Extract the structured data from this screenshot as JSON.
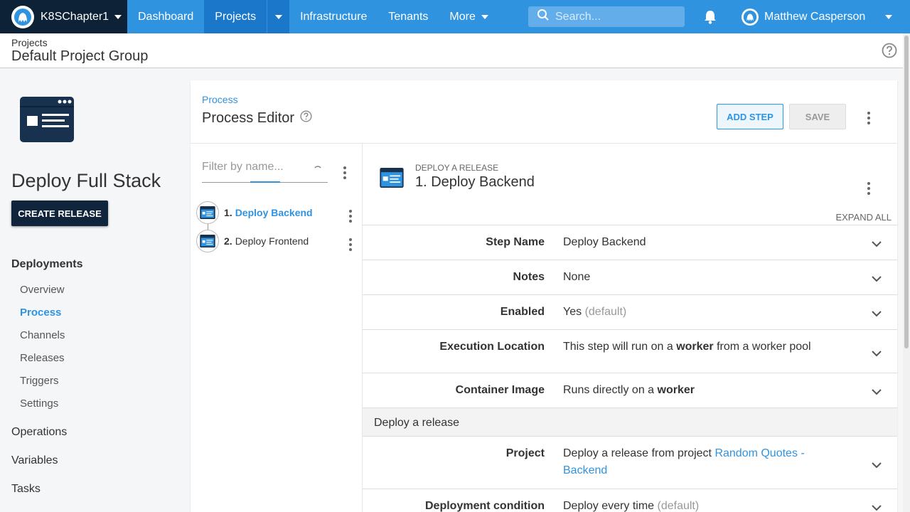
{
  "topnav": {
    "brand": "K8SChapter1",
    "items": [
      {
        "label": "Dashboard"
      },
      {
        "label": "Projects"
      },
      {
        "label": "Infrastructure"
      },
      {
        "label": "Tenants"
      },
      {
        "label": "More"
      }
    ],
    "search_placeholder": "Search...",
    "user_name": "Matthew Casperson"
  },
  "header": {
    "breadcrumb": "Projects",
    "title": "Default Project Group"
  },
  "sidebar": {
    "project_name": "Deploy Full Stack",
    "create_release": "CREATE RELEASE",
    "deployments": "Deployments",
    "sub_items": [
      {
        "label": "Overview"
      },
      {
        "label": "Process"
      },
      {
        "label": "Channels"
      },
      {
        "label": "Releases"
      },
      {
        "label": "Triggers"
      },
      {
        "label": "Settings"
      }
    ],
    "groups": [
      {
        "label": "Operations"
      },
      {
        "label": "Variables"
      },
      {
        "label": "Tasks"
      }
    ]
  },
  "editor": {
    "breadcrumb": "Process",
    "title": "Process Editor",
    "add_step": "ADD STEP",
    "save": "SAVE",
    "filter_placeholder": "Filter by name...",
    "steps": [
      {
        "num": "1.",
        "label": "Deploy Backend"
      },
      {
        "num": "2.",
        "label": "Deploy Frontend"
      }
    ]
  },
  "detail": {
    "step_type": "DEPLOY A RELEASE",
    "title": "1.  Deploy Backend",
    "expand_all": "EXPAND ALL",
    "rows": {
      "step_name": {
        "label": "Step Name",
        "value": "Deploy Backend"
      },
      "notes": {
        "label": "Notes",
        "value": "None"
      },
      "enabled": {
        "label": "Enabled",
        "value": "Yes",
        "suffix": "(default)"
      },
      "execution": {
        "label": "Execution Location",
        "pre": "This step will run on a ",
        "bold": "worker",
        "post": " from a worker pool"
      },
      "container": {
        "label": "Container Image",
        "pre": "Runs directly on a ",
        "bold": "worker"
      },
      "section": "Deploy a release",
      "project": {
        "label": "Project",
        "pre": "Deploy a release from project ",
        "link": "Random Quotes - Backend"
      },
      "condition": {
        "label": "Deployment condition",
        "value": "Deploy every time",
        "suffix": "(default)"
      }
    }
  },
  "colors": {
    "nav_blue": "#2f93e0",
    "nav_dark": "#0d2137",
    "accent": "#2f93e0"
  }
}
